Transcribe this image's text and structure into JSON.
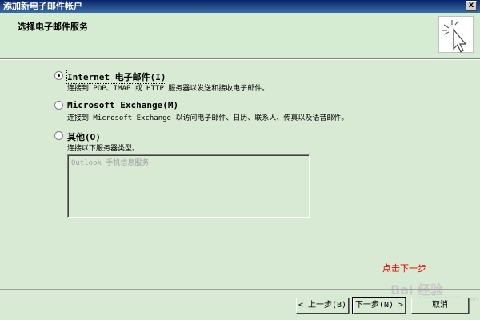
{
  "window": {
    "title": "添加新电子邮件帐户",
    "close_label": "x"
  },
  "banner": {
    "title": "选择电子邮件服务",
    "icon": "cursor-sparkle-icon"
  },
  "options": [
    {
      "label": "Internet 电子邮件(I)",
      "description": "连接到 POP、IMAP 或 HTTP 服务器以发送和接收电子邮件。",
      "checked": true
    },
    {
      "label": "Microsoft Exchange(M)",
      "description": "连接到 Microsoft Exchange 以访问电子邮件、日历、联系人、传真以及语音邮件。",
      "checked": false
    },
    {
      "label": "其他(O)",
      "description": "连接以下服务器类型。",
      "checked": false
    }
  ],
  "server_list": {
    "items": [
      "Outlook 手机信息服务"
    ]
  },
  "annotation": "点击下一步",
  "watermark": {
    "brand": "Bai 经验",
    "url": "jingyan.baidu.com"
  },
  "buttons": {
    "back": "< 上一步(B)",
    "next": "下一步(N) >",
    "cancel": "取消"
  },
  "colors": {
    "background": "#d8e9d4",
    "banner": "#d6ecd2",
    "titlebar": "#0a246a",
    "annotation": "#e00000"
  }
}
